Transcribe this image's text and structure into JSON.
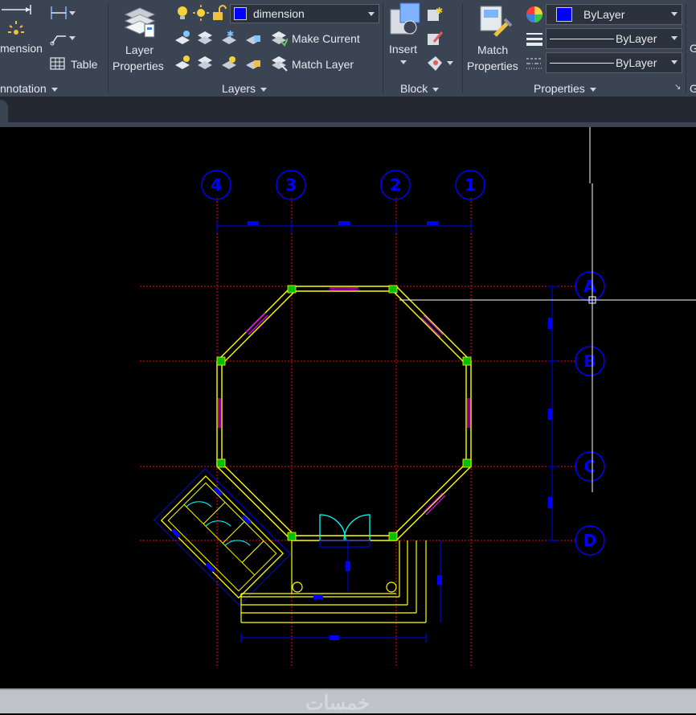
{
  "ribbon": {
    "annotation": {
      "title": "nnotation",
      "dimension_label": "mension",
      "table_label": "Table"
    },
    "layers": {
      "title": "Layers",
      "layer_properties_line1": "Layer",
      "layer_properties_line2": "Properties",
      "current_layer": "dimension",
      "current_layer_color": "#0000ff",
      "make_current": "Make Current",
      "match_layer": "Match Layer"
    },
    "block": {
      "title": "Block",
      "insert_label": "Insert"
    },
    "properties": {
      "title": "Properties",
      "match_line1": "Match",
      "match_line2": "Properties",
      "color_value": "ByLayer",
      "color_swatch": "#0000ff",
      "linetype_value": "ByLayer",
      "lineweight_value": "ByLayer"
    },
    "extra_label": "G"
  },
  "drawing": {
    "grid_bubbles_top": [
      "4",
      "3",
      "2",
      "1"
    ],
    "grid_bubbles_right": [
      "A",
      "B",
      "C",
      "D"
    ],
    "colors": {
      "grid_line": "#ff0000",
      "wall": "#ffff00",
      "dimension": "#0000ff",
      "door": "#00ffff",
      "hatch": "#00ff00",
      "window": "#ff00ff",
      "crosshair": "#ffffff"
    }
  },
  "statusbar": {
    "watermark": "خمسات"
  }
}
